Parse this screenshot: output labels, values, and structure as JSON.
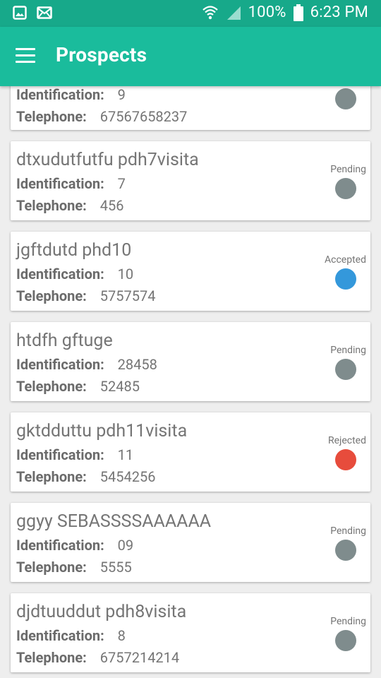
{
  "status_bar": {
    "battery": "100%",
    "time": "6:23 PM"
  },
  "app_bar": {
    "title": "Prospects",
    "menu_icon": "hamburger-menu-icon"
  },
  "labels": {
    "identification": "Identification:",
    "telephone": "Telephone:"
  },
  "status_colors": {
    "Pending": "#7f8c8d",
    "Accepted": "#3498db",
    "Rejected": "#e74c3c"
  },
  "prospects": [
    {
      "name": "",
      "identification": "9",
      "telephone": "67567658237",
      "status": ""
    },
    {
      "name": "dtxudutfutfu pdh7visita",
      "identification": "7",
      "telephone": "456",
      "status": "Pending"
    },
    {
      "name": "jgftdutd phd10",
      "identification": "10",
      "telephone": "5757574",
      "status": "Accepted"
    },
    {
      "name": "htdfh gftuge",
      "identification": "28458",
      "telephone": "52485",
      "status": "Pending"
    },
    {
      "name": "gktdduttu pdh11visita",
      "identification": "11",
      "telephone": "5454256",
      "status": "Rejected"
    },
    {
      "name": "ggyy SEBASSSSAAAAAA",
      "identification": "09",
      "telephone": "5555",
      "status": "Pending"
    },
    {
      "name": "djdtuuddut pdh8visita",
      "identification": "8",
      "telephone": "6757214214",
      "status": "Pending"
    }
  ]
}
